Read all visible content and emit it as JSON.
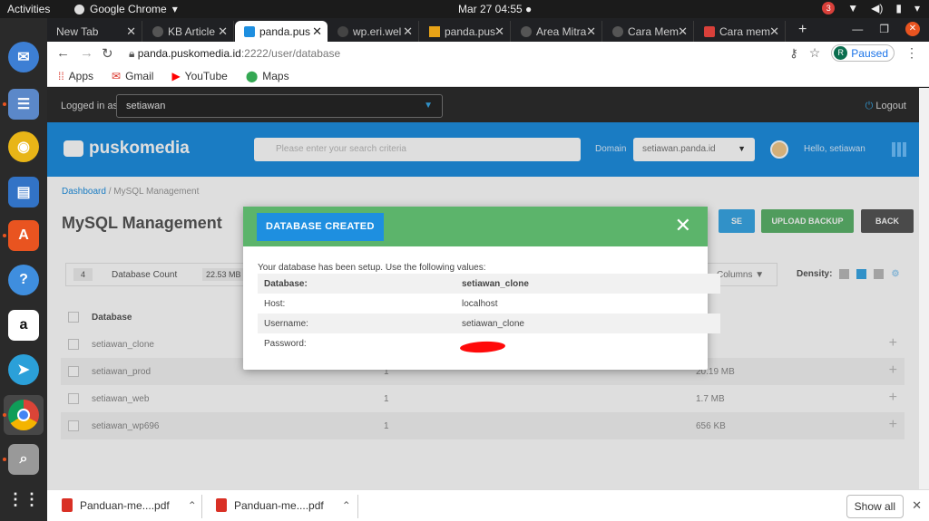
{
  "topbar": {
    "activities": "Activities",
    "app": "Google Chrome",
    "clock": "Mar 27  04:55 ●",
    "notif_count": "3"
  },
  "tabs": [
    {
      "label": "New Tab"
    },
    {
      "label": "KB Article"
    },
    {
      "label": "panda.pus"
    },
    {
      "label": "wp.eri.wel"
    },
    {
      "label": "panda.pus"
    },
    {
      "label": "Area Mitra"
    },
    {
      "label": "Cara Mem"
    },
    {
      "label": "Cara mem"
    }
  ],
  "address": {
    "host": "panda.puskomedia.id",
    "path": ":2222/user/database"
  },
  "profile": {
    "initial": "R",
    "status": "Paused"
  },
  "bookmarks": [
    {
      "label": "Apps"
    },
    {
      "label": "Gmail"
    },
    {
      "label": "YouTube"
    },
    {
      "label": "Maps"
    }
  ],
  "panel": {
    "logged_in_label": "Logged in as",
    "user": "setiawan",
    "logout": "Logout",
    "brand": "puskomedia",
    "search_placeholder": "Please enter your search criteria",
    "domain_label": "Domain",
    "domain_value": "setiawan.panda.id",
    "hello": "Hello, setiawan",
    "breadcrumb_home": "Dashboard",
    "breadcrumb_current": " / MySQL Management",
    "title": "MySQL Management",
    "buttons": {
      "create": "SE",
      "upload": "UPLOAD BACKUP",
      "back": "BACK"
    },
    "count_num": "4",
    "count_label": "Database Count",
    "count_size": "22.53 MB",
    "columns": "Columns",
    "density": "Density:",
    "col_database": "Database"
  },
  "databases": [
    {
      "name": "setiawan_clone",
      "users": "",
      "size": ""
    },
    {
      "name": "setiawan_prod",
      "users": "1",
      "size": "20.19 MB"
    },
    {
      "name": "setiawan_web",
      "users": "1",
      "size": "1.7 MB"
    },
    {
      "name": "setiawan_wp696",
      "users": "1",
      "size": "656 KB"
    }
  ],
  "modal": {
    "title": "DATABASE CREATED",
    "intro": "Your database has been setup. Use the following values:",
    "fields": [
      {
        "key": "Database:",
        "value": "setiawan_clone"
      },
      {
        "key": "Host:",
        "value": "localhost"
      },
      {
        "key": "Username:",
        "value": "setiawan_clone"
      },
      {
        "key": "Password:",
        "value": ""
      }
    ]
  },
  "downloads": [
    {
      "name": "Panduan-me....pdf"
    },
    {
      "name": "Panduan-me....pdf"
    }
  ],
  "show_all": "Show all",
  "colors": {
    "brand_blue": "#1e8fe0",
    "success_green": "#5cb46b",
    "redaction": "#ff0a0a"
  }
}
